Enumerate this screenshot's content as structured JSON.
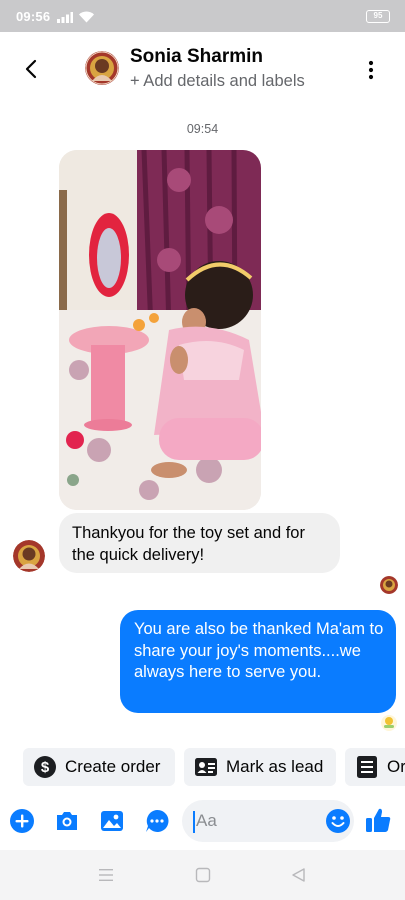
{
  "status_bar": {
    "time": "09:56",
    "battery": "95"
  },
  "header": {
    "contact_name": "Sonia Sharmin",
    "subtitle": "+ Add details and labels"
  },
  "conversation": {
    "timestamp": "09:54",
    "incoming_text": "Thankyou for the toy set and for the quick delivery!",
    "outgoing_text": "You are also be thanked Ma'am to share your joy's moments....we always here to serve you."
  },
  "quick_actions": [
    {
      "label": "Create order",
      "icon": "dollar-circle-icon"
    },
    {
      "label": "Mark as lead",
      "icon": "contact-card-icon"
    },
    {
      "label": "Or",
      "icon": "list-document-icon"
    }
  ],
  "composer": {
    "placeholder": "Aa"
  },
  "colors": {
    "accent": "#0a7cff",
    "bubble_in": "#f0f0f0",
    "status_bar": "#c9c9cb"
  }
}
